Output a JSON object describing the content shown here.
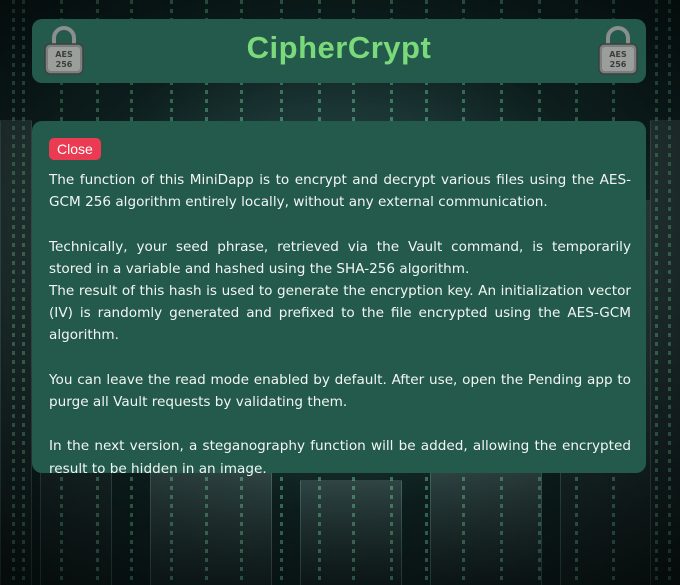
{
  "app": {
    "title": "CipherCrypt",
    "lock_label": "AES 256"
  },
  "panel": {
    "close_label": "Close",
    "paragraphs": [
      "The function of this MiniDapp is to encrypt and decrypt various files using the AES-GCM 256 algorithm entirely locally, without any external communication.",
      "Technically, your seed phrase, retrieved via the Vault command, is temporarily stored in a variable and hashed using the SHA-256 algorithm.",
      "The result of this hash is used to generate the encryption key. An initialization vector (IV) is randomly generated and prefixed to the file encrypted using the AES-GCM algorithm.",
      "You can leave the read mode enabled by default. After use, open the Pending app to purge all Vault requests by validating them.",
      "In the next version, a steganography function will be added, allowing the encrypted result to be hidden in an image."
    ]
  },
  "colors": {
    "panel_bg": "#245a4b",
    "title": "#7ad97a",
    "close_button": "#ea3b52",
    "text": "#f2f6f4"
  },
  "icons": [
    "padlock-icon",
    "padlock-icon"
  ],
  "background": "matrix-city-image"
}
